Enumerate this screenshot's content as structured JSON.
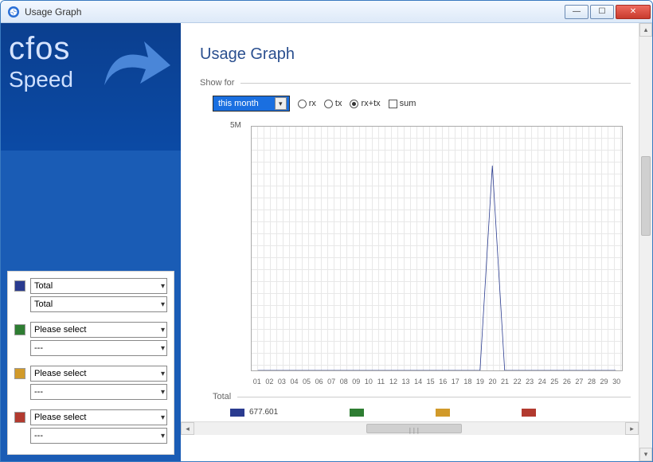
{
  "window": {
    "title": "Usage Graph"
  },
  "logo": {
    "top": "cfos",
    "bottom": "Speed"
  },
  "selectors": [
    {
      "color": "#2a3b8f",
      "primary": "Total",
      "secondary": "Total"
    },
    {
      "color": "#2e7d32",
      "primary": "Please select",
      "secondary": "---"
    },
    {
      "color": "#d19a2a",
      "primary": "Please select",
      "secondary": "---"
    },
    {
      "color": "#b23a2f",
      "primary": "Please select",
      "secondary": "---"
    }
  ],
  "page": {
    "heading": "Usage Graph",
    "showfor_legend": "Show for",
    "period_selected": "this month",
    "radios": {
      "rx": "rx",
      "tx": "tx",
      "rxtx": "rx+tx"
    },
    "checkbox_sum": "sum",
    "total_legend": "Total",
    "legend_value": "677.601"
  },
  "chart_data": {
    "type": "line",
    "title": "",
    "xlabel": "",
    "ylabel": "",
    "ylim": [
      0,
      5000000
    ],
    "ytick_label": "5M",
    "categories": [
      "01",
      "02",
      "03",
      "04",
      "05",
      "06",
      "07",
      "08",
      "09",
      "10",
      "11",
      "12",
      "13",
      "14",
      "15",
      "16",
      "17",
      "18",
      "19",
      "20",
      "21",
      "22",
      "23",
      "24",
      "25",
      "26",
      "27",
      "28",
      "29",
      "30"
    ],
    "series": [
      {
        "name": "Total",
        "color": "#2a3b8f",
        "values": [
          0,
          0,
          0,
          0,
          0,
          0,
          0,
          0,
          0,
          0,
          0,
          0,
          0,
          0,
          0,
          0,
          0,
          0,
          0,
          4200000,
          0,
          0,
          0,
          0,
          0,
          0,
          0,
          0,
          0,
          0
        ]
      }
    ],
    "legend_colors": [
      "#2a3b8f",
      "#2e7d32",
      "#d19a2a",
      "#b23a2f"
    ]
  }
}
